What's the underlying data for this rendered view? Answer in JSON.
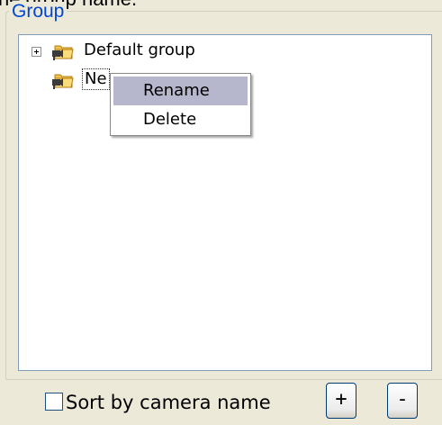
{
  "header": {
    "caption": "he group name."
  },
  "group": {
    "title": "Group",
    "tree": [
      {
        "label": "Default group",
        "expandable": true,
        "icon": "camera-folder-icon"
      },
      {
        "label": "Ne",
        "selected": true,
        "icon": "camera-folder-icon"
      }
    ]
  },
  "context_menu": {
    "items": [
      {
        "label": "Rename",
        "highlighted": true
      },
      {
        "label": "Delete",
        "highlighted": false
      }
    ]
  },
  "options": {
    "sort_label": "Sort by camera name",
    "sort_checked": false
  },
  "buttons": {
    "add_label": "+",
    "remove_label": "-"
  },
  "colors": {
    "window_bg": "#ece9d8",
    "groupbox_title": "#0046d5",
    "menu_highlight": "#b6b6cc",
    "tree_border": "#7f9db9"
  }
}
